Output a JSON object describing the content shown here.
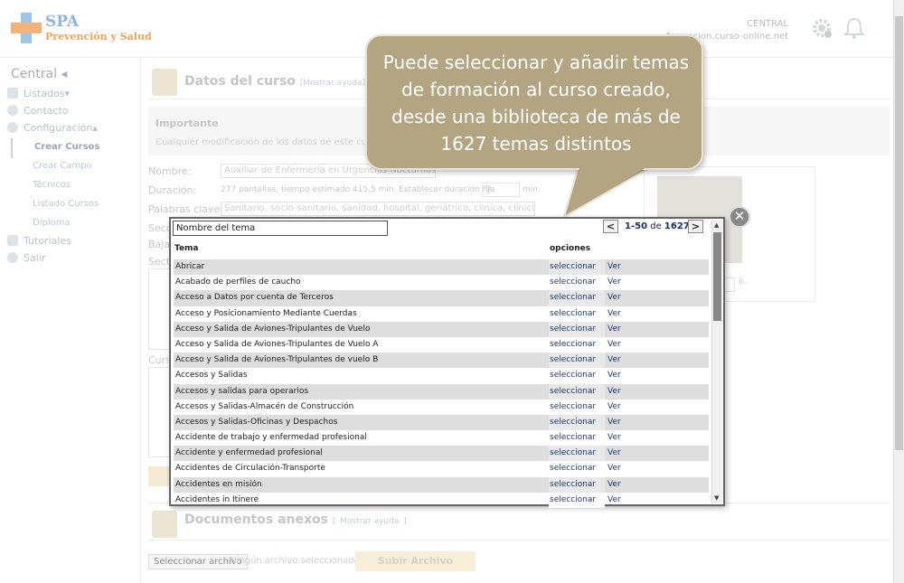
{
  "header": {
    "logo_line1": "SPA",
    "logo_line2": "Prevención y Salud",
    "account_name": "CENTRAL",
    "account_domain": "formacion.curso-online.net"
  },
  "sidebar": {
    "title": "Central ◂",
    "items": [
      {
        "label": "Listados▾"
      },
      {
        "label": "Contacto"
      },
      {
        "label": "Configuración▴"
      }
    ],
    "subitems": [
      "Crear Cursos",
      "Crear Campo",
      "Técnicos",
      "Listado Cursos",
      "Diploma"
    ],
    "bottom_items": [
      "Tutoriales",
      "Salir"
    ]
  },
  "main": {
    "section1_title": "Datos del curso",
    "section1_help": "[Mostrar ayuda]",
    "important_title": "Importante",
    "important_text": "Cualquier modificación de los datos de este curso afe",
    "labels": {
      "nombre": "Nombre:",
      "duracion": "Duración:",
      "palabras": "Palabras clave:",
      "secc": "Secc",
      "baja": "Baja",
      "sect": "Sect",
      "curs": "Curs"
    },
    "nombre_value": "Auxiliar de Enfermería en Urgencias Nocturnas",
    "duracion_text": "277 pantallas, tiempo estimado 415,5 min. Establecer duración fija",
    "duracion_value": "0",
    "duracion_unit": "min.",
    "palabras_value": "Sanitario, socio-sanitario, sanidad, hospital, geriátrico, clínica, clínico, enfer",
    "photo_caption": "Il..",
    "section2_title": "Documentos anexos",
    "section2_help_open": "[",
    "section2_help": "Mostrar ayuda",
    "section2_help_close": "]",
    "file_button": "Seleccionar archivo",
    "no_file_text": "Ningún archivo seleccionado",
    "upload_button": "Subir Archivo"
  },
  "callout": {
    "text": "Puede seleccionar y añadir temas de formación al curso creado, desde una biblioteca de más de 1627 temas distintos"
  },
  "modal": {
    "search_value": "Nombre del tema",
    "pager_range": "1-50",
    "pager_de": "de",
    "pager_total": "1627",
    "prev_label": "<",
    "next_label": ">",
    "close_label": "✕",
    "col_tema": "Tema",
    "col_opciones": "opciones",
    "action_select": "seleccionar",
    "action_view": "Ver",
    "rows": [
      "Abricar",
      "Acabado de perfiles de caucho",
      "Acceso a Datos por cuenta de Terceros",
      "Acceso y Posicionamiento Mediante Cuerdas",
      "Acceso y Salida de Aviones-Tripulantes de Vuelo",
      "Acceso y Salida de Aviones-Tripulantes de Vuelo A",
      "Acceso y Salida de Aviones-Tripulantes de vuelo B",
      "Accesos y Salidas",
      "Accesos y salidas para operarios",
      "Accesos y Salidas-Almacén de Construcción",
      "Accesos y Salidas-Oficinas y Despachos",
      "Accidente de trabajo y enfermedad profesional",
      "Accidente y enfermedad profesional",
      "Accidentes de Circulación-Transporte",
      "Accidentes en misión",
      "Accidentes in Itinere"
    ]
  },
  "colors": {
    "callout_bg": "#b3a582",
    "link": "#243a7a",
    "row_alt": "#dedede",
    "accent_orange": "#f0a35a"
  }
}
